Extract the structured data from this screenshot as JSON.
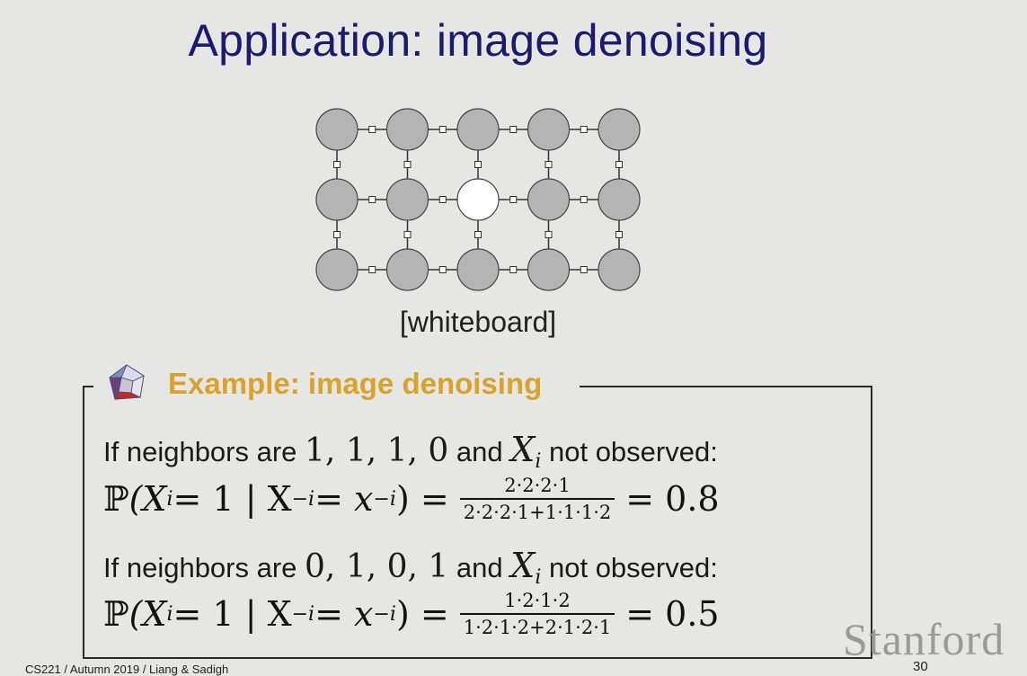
{
  "slide": {
    "title": "Application: image denoising",
    "caption": "[whiteboard]",
    "footer": "CS221 / Autumn 2019 / Liang & Sadigh",
    "page_number": "30",
    "watermark": "Stanford"
  },
  "grid": {
    "rows": 3,
    "cols": 5,
    "unobserved_node": {
      "row": 1,
      "col": 2
    },
    "node_color": "#b4b4b4",
    "unobserved_color": "#ffffff"
  },
  "example": {
    "title": "Example: image denoising",
    "case1": {
      "prefix": "If neighbors are ",
      "neighbors": "1, 1, 1, 0",
      "mid": " and ",
      "var": "X",
      "var_sub": "i",
      "suffix": " not observed:",
      "lhs_P": "ℙ",
      "lhs": "(X",
      "lhs_sub": "i",
      "lhs_mid": " = 1 | X",
      "lhs_sub2": "−i",
      "lhs_mid2": " = x",
      "lhs_sub3": "−i",
      "lhs_end": ") =",
      "numerator": "2·2·2·1",
      "denominator": "2·2·2·1+1·1·1·2",
      "result": "= 0.8"
    },
    "case2": {
      "prefix": "If neighbors are ",
      "neighbors": "0, 1, 0, 1",
      "mid": " and ",
      "var": "X",
      "var_sub": "i",
      "suffix": " not observed:",
      "lhs_P": "ℙ",
      "lhs": "(X",
      "lhs_sub": "i",
      "lhs_mid": " = 1 | X",
      "lhs_sub2": "−i",
      "lhs_mid2": " = x",
      "lhs_sub3": "−i",
      "lhs_end": ") =",
      "numerator": "1·2·1·2",
      "denominator": "1·2·1·2+2·1·2·1",
      "result": "= 0.5"
    }
  },
  "colors": {
    "title": "#1b1b6e",
    "example_title": "#d9a22c"
  }
}
